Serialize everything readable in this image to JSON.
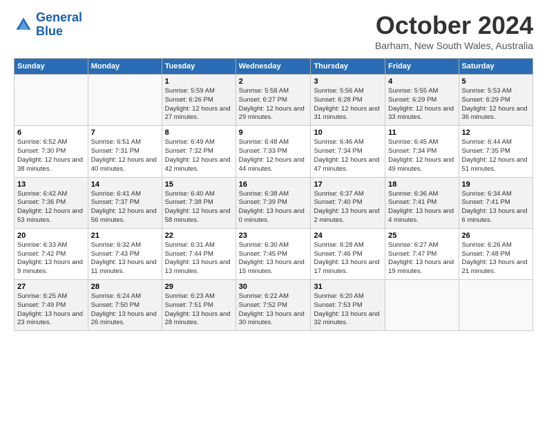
{
  "logo": {
    "line1": "General",
    "line2": "Blue"
  },
  "title": "October 2024",
  "subtitle": "Barham, New South Wales, Australia",
  "days_of_week": [
    "Sunday",
    "Monday",
    "Tuesday",
    "Wednesday",
    "Thursday",
    "Friday",
    "Saturday"
  ],
  "weeks": [
    [
      {
        "day": "",
        "info": ""
      },
      {
        "day": "",
        "info": ""
      },
      {
        "day": "1",
        "info": "Sunrise: 5:59 AM\nSunset: 6:26 PM\nDaylight: 12 hours\nand 27 minutes."
      },
      {
        "day": "2",
        "info": "Sunrise: 5:58 AM\nSunset: 6:27 PM\nDaylight: 12 hours\nand 29 minutes."
      },
      {
        "day": "3",
        "info": "Sunrise: 5:56 AM\nSunset: 6:28 PM\nDaylight: 12 hours\nand 31 minutes."
      },
      {
        "day": "4",
        "info": "Sunrise: 5:55 AM\nSunset: 6:29 PM\nDaylight: 12 hours\nand 33 minutes."
      },
      {
        "day": "5",
        "info": "Sunrise: 5:53 AM\nSunset: 6:29 PM\nDaylight: 12 hours\nand 36 minutes."
      }
    ],
    [
      {
        "day": "6",
        "info": "Sunrise: 6:52 AM\nSunset: 7:30 PM\nDaylight: 12 hours\nand 38 minutes."
      },
      {
        "day": "7",
        "info": "Sunrise: 6:51 AM\nSunset: 7:31 PM\nDaylight: 12 hours\nand 40 minutes."
      },
      {
        "day": "8",
        "info": "Sunrise: 6:49 AM\nSunset: 7:32 PM\nDaylight: 12 hours\nand 42 minutes."
      },
      {
        "day": "9",
        "info": "Sunrise: 6:48 AM\nSunset: 7:33 PM\nDaylight: 12 hours\nand 44 minutes."
      },
      {
        "day": "10",
        "info": "Sunrise: 6:46 AM\nSunset: 7:34 PM\nDaylight: 12 hours\nand 47 minutes."
      },
      {
        "day": "11",
        "info": "Sunrise: 6:45 AM\nSunset: 7:34 PM\nDaylight: 12 hours\nand 49 minutes."
      },
      {
        "day": "12",
        "info": "Sunrise: 6:44 AM\nSunset: 7:35 PM\nDaylight: 12 hours\nand 51 minutes."
      }
    ],
    [
      {
        "day": "13",
        "info": "Sunrise: 6:42 AM\nSunset: 7:36 PM\nDaylight: 12 hours\nand 53 minutes."
      },
      {
        "day": "14",
        "info": "Sunrise: 6:41 AM\nSunset: 7:37 PM\nDaylight: 12 hours\nand 56 minutes."
      },
      {
        "day": "15",
        "info": "Sunrise: 6:40 AM\nSunset: 7:38 PM\nDaylight: 12 hours\nand 58 minutes."
      },
      {
        "day": "16",
        "info": "Sunrise: 6:38 AM\nSunset: 7:39 PM\nDaylight: 13 hours\nand 0 minutes."
      },
      {
        "day": "17",
        "info": "Sunrise: 6:37 AM\nSunset: 7:40 PM\nDaylight: 13 hours\nand 2 minutes."
      },
      {
        "day": "18",
        "info": "Sunrise: 6:36 AM\nSunset: 7:41 PM\nDaylight: 13 hours\nand 4 minutes."
      },
      {
        "day": "19",
        "info": "Sunrise: 6:34 AM\nSunset: 7:41 PM\nDaylight: 13 hours\nand 6 minutes."
      }
    ],
    [
      {
        "day": "20",
        "info": "Sunrise: 6:33 AM\nSunset: 7:42 PM\nDaylight: 13 hours\nand 9 minutes."
      },
      {
        "day": "21",
        "info": "Sunrise: 6:32 AM\nSunset: 7:43 PM\nDaylight: 13 hours\nand 11 minutes."
      },
      {
        "day": "22",
        "info": "Sunrise: 6:31 AM\nSunset: 7:44 PM\nDaylight: 13 hours\nand 13 minutes."
      },
      {
        "day": "23",
        "info": "Sunrise: 6:30 AM\nSunset: 7:45 PM\nDaylight: 13 hours\nand 15 minutes."
      },
      {
        "day": "24",
        "info": "Sunrise: 6:28 AM\nSunset: 7:46 PM\nDaylight: 13 hours\nand 17 minutes."
      },
      {
        "day": "25",
        "info": "Sunrise: 6:27 AM\nSunset: 7:47 PM\nDaylight: 13 hours\nand 19 minutes."
      },
      {
        "day": "26",
        "info": "Sunrise: 6:26 AM\nSunset: 7:48 PM\nDaylight: 13 hours\nand 21 minutes."
      }
    ],
    [
      {
        "day": "27",
        "info": "Sunrise: 6:25 AM\nSunset: 7:49 PM\nDaylight: 13 hours\nand 23 minutes."
      },
      {
        "day": "28",
        "info": "Sunrise: 6:24 AM\nSunset: 7:50 PM\nDaylight: 13 hours\nand 26 minutes."
      },
      {
        "day": "29",
        "info": "Sunrise: 6:23 AM\nSunset: 7:51 PM\nDaylight: 13 hours\nand 28 minutes."
      },
      {
        "day": "30",
        "info": "Sunrise: 6:22 AM\nSunset: 7:52 PM\nDaylight: 13 hours\nand 30 minutes."
      },
      {
        "day": "31",
        "info": "Sunrise: 6:20 AM\nSunset: 7:53 PM\nDaylight: 13 hours\nand 32 minutes."
      },
      {
        "day": "",
        "info": ""
      },
      {
        "day": "",
        "info": ""
      }
    ]
  ]
}
